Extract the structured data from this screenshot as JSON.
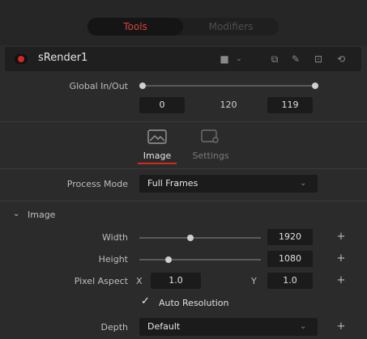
{
  "tabs": {
    "tools": "Tools",
    "modifiers": "Modifiers"
  },
  "node": {
    "name": "sRender1"
  },
  "global_inout": {
    "label": "Global In/Out",
    "in_value": "0",
    "mid_value": "120",
    "out_value": "119"
  },
  "panel_tabs": {
    "image": "Image",
    "settings": "Settings"
  },
  "process_mode": {
    "label": "Process Mode",
    "value": "Full Frames"
  },
  "image_section": {
    "header": "Image",
    "width_label": "Width",
    "width_value": "1920",
    "width_level": 0.42,
    "height_label": "Height",
    "height_value": "1080",
    "height_level": 0.24,
    "pixel_aspect_label": "Pixel Aspect",
    "x_label": "X",
    "x_value": "1.0",
    "y_label": "Y",
    "y_value": "1.0",
    "auto_resolution": "Auto Resolution",
    "depth_label": "Depth",
    "depth_value": "Default"
  },
  "colors": {
    "accent": "#d32a20",
    "panel": "#2b2b2b",
    "field": "#1b1b1b"
  }
}
